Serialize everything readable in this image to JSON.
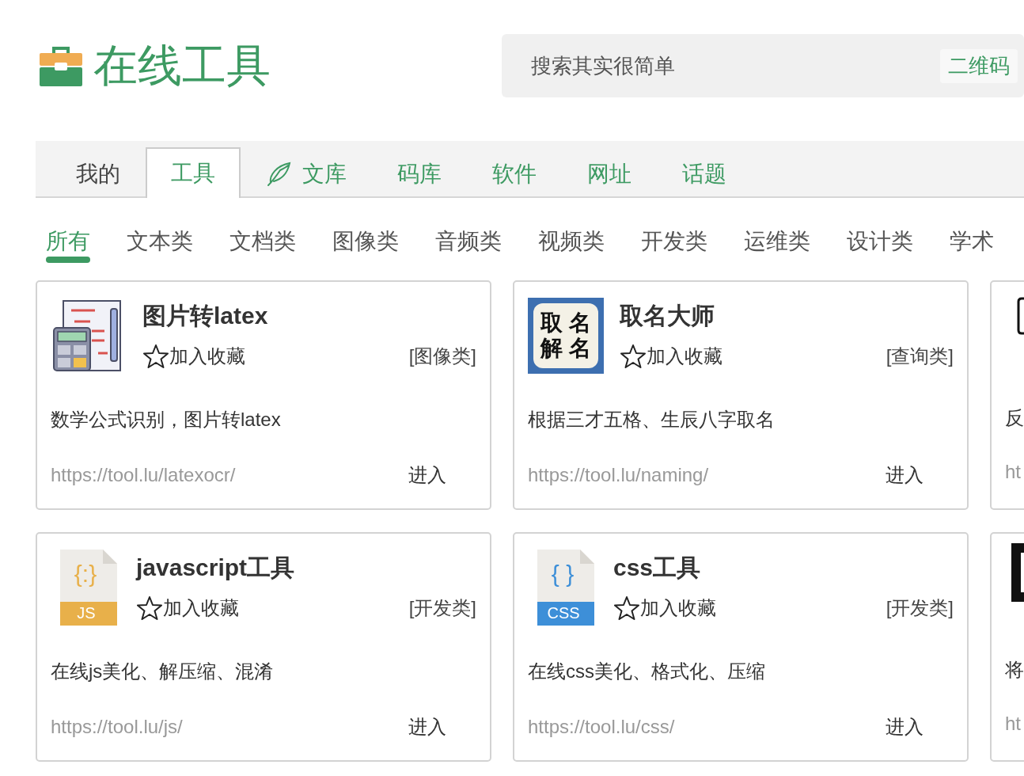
{
  "logo": {
    "title": "在线工具"
  },
  "search": {
    "placeholder": "搜索其实很简单",
    "qr_button": "二维码"
  },
  "tabs": [
    {
      "label": "我的",
      "kind": "personal",
      "selected": false
    },
    {
      "label": "工具",
      "kind": "section",
      "selected": true
    },
    {
      "label": "文库",
      "kind": "library",
      "selected": false
    },
    {
      "label": "码库",
      "kind": "section",
      "selected": false
    },
    {
      "label": "软件",
      "kind": "section",
      "selected": false
    },
    {
      "label": "网址",
      "kind": "section",
      "selected": false
    },
    {
      "label": "话题",
      "kind": "section",
      "selected": false
    }
  ],
  "categories": [
    {
      "label": "所有",
      "selected": true
    },
    {
      "label": "文本类",
      "selected": false
    },
    {
      "label": "文档类",
      "selected": false
    },
    {
      "label": "图像类",
      "selected": false
    },
    {
      "label": "音频类",
      "selected": false
    },
    {
      "label": "视频类",
      "selected": false
    },
    {
      "label": "开发类",
      "selected": false
    },
    {
      "label": "运维类",
      "selected": false
    },
    {
      "label": "设计类",
      "selected": false
    },
    {
      "label": "学术",
      "selected": false
    }
  ],
  "cards": [
    {
      "kind": "latex",
      "title": "图片转latex",
      "favorite": "加入收藏",
      "category": "[图像类]",
      "description": "数学公式识别，图片转latex",
      "url": "https://tool.lu/latexocr/",
      "enter": "进入"
    },
    {
      "kind": "naming",
      "icon_lines": [
        "取名",
        "解名"
      ],
      "title": "取名大师",
      "favorite": "加入收藏",
      "category": "[查询类]",
      "description": "根据三才五格、生辰八字取名",
      "url": "https://tool.lu/naming/",
      "enter": "进入"
    },
    {
      "kind": "frame",
      "description": "反",
      "url": "ht"
    },
    {
      "kind": "file",
      "icon_glyph": "{:}",
      "icon_label": "JS",
      "color": "#e8b04a",
      "title": "javascript工具",
      "favorite": "加入收藏",
      "category": "[开发类]",
      "description": "在线js美化、解压缩、混淆",
      "url": "https://tool.lu/js/",
      "enter": "进入"
    },
    {
      "kind": "file",
      "icon_glyph": "{ }",
      "icon_label": "CSS",
      "color": "#3d8fd8",
      "title": "css工具",
      "favorite": "加入收藏",
      "category": "[开发类]",
      "description": "在线css美化、格式化、压缩",
      "url": "https://tool.lu/css/",
      "enter": "进入"
    },
    {
      "kind": "block",
      "description": "将",
      "url": "ht"
    }
  ]
}
